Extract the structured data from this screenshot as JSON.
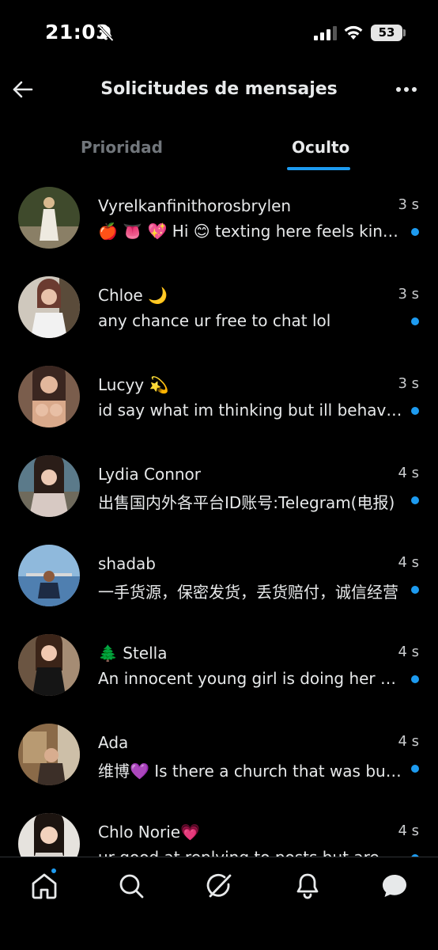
{
  "status_bar": {
    "time": "21:03",
    "battery": "53"
  },
  "header": {
    "title": "Solicitudes de mensajes"
  },
  "tabs": [
    {
      "label": "Prioridad",
      "active": false
    },
    {
      "label": "Oculto",
      "active": true
    }
  ],
  "conversations": [
    {
      "name": "Vyrelkanfinithorosbrylen",
      "time": "3 s",
      "preview": "🍎 👅 💖 Hi 😊 texting here feels kind of fun",
      "unread": true
    },
    {
      "name": "Chloe 🌙",
      "time": "3 s",
      "preview": "any chance ur free to chat lol",
      "unread": true
    },
    {
      "name": "Lucyy 💫",
      "time": "3 s",
      "preview": "id say what im thinking but ill behave for now",
      "unread": true
    },
    {
      "name": "Lydia Connor",
      "time": "4 s",
      "preview": "出售国内外各平台ID账号:Telegram(电报)",
      "unread": true
    },
    {
      "name": "shadab",
      "time": "4 s",
      "preview": "一手货源，保密发货，丢货赔付，诚信经营",
      "unread": true
    },
    {
      "name": "🌲 Stella",
      "time": "4 s",
      "preview": "An innocent young girl is doing her first time",
      "unread": true
    },
    {
      "name": "Ada",
      "time": "4 s",
      "preview": "维博💜 Is there a church that was built near you",
      "unread": true
    },
    {
      "name": "Chlo Norie💗",
      "time": "4 s",
      "preview": "ur good at replying to posts but are you good at",
      "unread": true
    }
  ],
  "colors": {
    "accent": "#1d9bf0",
    "background": "#000000",
    "text_primary": "#e7e9ea",
    "text_secondary": "#71767b"
  },
  "icons": {
    "status": [
      "bell-slash-icon",
      "cellular-signal-icon",
      "wifi-icon",
      "battery-icon"
    ],
    "header": [
      "back-arrow-icon",
      "more-dots-icon"
    ],
    "nav": [
      "home-icon",
      "search-icon",
      "grok-icon",
      "bell-icon",
      "messages-icon"
    ]
  }
}
